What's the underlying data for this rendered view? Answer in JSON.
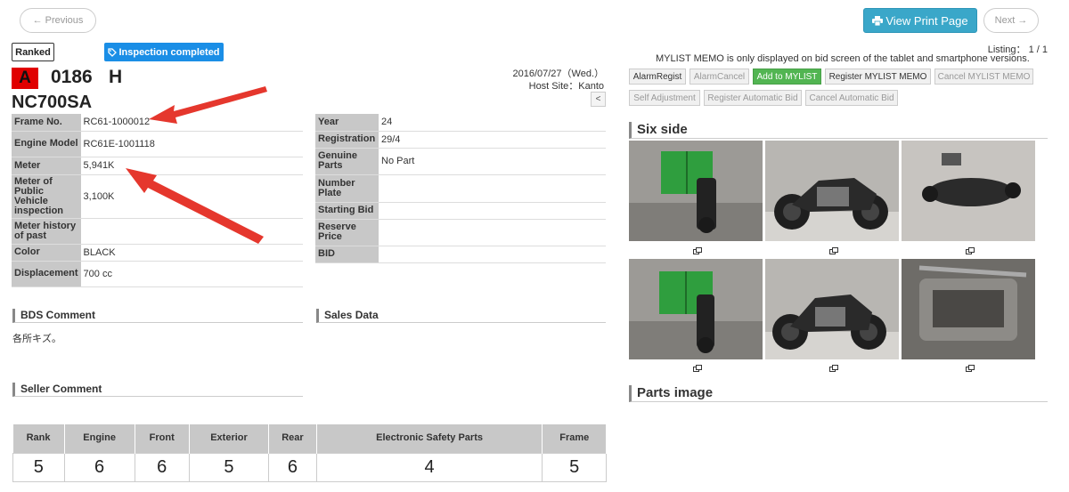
{
  "nav": {
    "previous_label": "← Previous",
    "next_label": "Next →",
    "print_label": "View Print Page"
  },
  "badges": {
    "rank": "Ranked",
    "inspection": "Inspection completed"
  },
  "lot": {
    "lane": "A",
    "number": "0186",
    "suffix": "H",
    "model": "NC700SA",
    "date": "2016/07/27（Wed.）",
    "host_site": "Host Site：Kanto",
    "collapse": "<"
  },
  "left_spec": [
    {
      "key": "Frame No.",
      "value": "RC61-1000012"
    },
    {
      "key": "Engine Model",
      "value": "RC61E-1001118"
    },
    {
      "key": "Meter",
      "value": "5,941K"
    },
    {
      "key": "Meter of Public Vehicle inspection",
      "value": "3,100K"
    },
    {
      "key": "Meter history of past",
      "value": ""
    },
    {
      "key": "Color",
      "value": "BLACK"
    },
    {
      "key": "Displacement",
      "value": "700 cc"
    }
  ],
  "right_spec": [
    {
      "key": "Year",
      "value": "24"
    },
    {
      "key": "Registration",
      "value": "29/4"
    },
    {
      "key": "Genuine Parts",
      "value": "No Part"
    },
    {
      "key": "Number Plate",
      "value": ""
    },
    {
      "key": "Starting Bid",
      "value": ""
    },
    {
      "key": "Reserve Price",
      "value": ""
    },
    {
      "key": "BID",
      "value": ""
    }
  ],
  "sections": {
    "bds": "BDS Comment",
    "bds_text": "各所キズ。",
    "sales": "Sales Data",
    "seller": "Seller Comment",
    "six_side": "Six side",
    "parts": "Parts image"
  },
  "grades": {
    "headers": [
      "Rank",
      "Engine",
      "Front",
      "Exterior",
      "Rear",
      "Electronic Safety Parts",
      "Frame"
    ],
    "values": [
      "5",
      "6",
      "6",
      "5",
      "6",
      "4",
      "5"
    ]
  },
  "listing": {
    "count": "Listing： 1 / 1",
    "mylist_note": "MYLIST MEMO is only displayed on bid screen of the tablet and smartphone versions."
  },
  "actions": {
    "alarm_regist": "AlarmRegist",
    "alarm_cancel": "AlarmCancel",
    "add_mylist": "Add to MYLIST",
    "register_memo": "Register MYLIST MEMO",
    "cancel_memo": "Cancel MYLIST MEMO",
    "self_adjustment": "Self Adjustment",
    "register_auto_bid": "Register Automatic Bid",
    "cancel_auto_bid": "Cancel Automatic Bid"
  },
  "colors": {
    "print_button": "#3aa7c9",
    "inspection_badge": "#1a8ee6",
    "lane_red": "#e00000",
    "add_mylist_green": "#52b552",
    "arrow_red": "#e5372d"
  },
  "icons": {
    "print": "printer-icon",
    "inspection": "tag-icon",
    "zoom": "expand-icon"
  }
}
